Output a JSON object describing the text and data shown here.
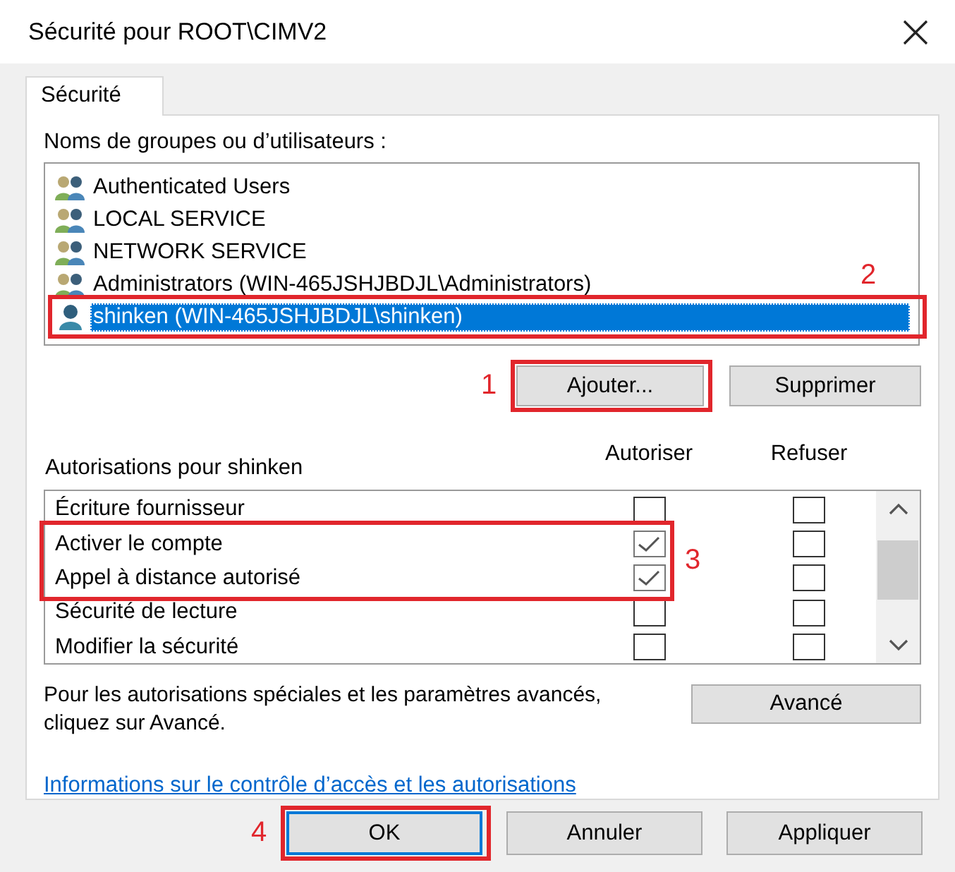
{
  "window": {
    "title": "Sécurité pour ROOT\\CIMV2"
  },
  "tabs": [
    {
      "label": "Sécurité",
      "selected": true
    }
  ],
  "groups": {
    "label": "Noms de groupes ou d’utilisateurs :",
    "callout": "2",
    "items": [
      {
        "name": "Authenticated Users",
        "kind": "group",
        "selected": false,
        "highlighted": false
      },
      {
        "name": "LOCAL SERVICE",
        "kind": "group",
        "selected": false,
        "highlighted": false
      },
      {
        "name": "NETWORK SERVICE",
        "kind": "group",
        "selected": false,
        "highlighted": false
      },
      {
        "name": "Administrators (WIN-465JSHJBDJL\\Administrators)",
        "kind": "group",
        "selected": false,
        "highlighted": false
      },
      {
        "name": "shinken (WIN-465JSHJBDJL\\shinken)",
        "kind": "user",
        "selected": true,
        "highlighted": true
      }
    ]
  },
  "group_buttons": [
    {
      "label": "Ajouter...",
      "highlighted": true,
      "callout": "1"
    },
    {
      "label": "Supprimer"
    }
  ],
  "permissions": {
    "label": "Autorisations pour shinken",
    "allow_header": "Autoriser",
    "deny_header": "Refuser",
    "callout": "3",
    "rows": [
      {
        "name": "Écriture fournisseur",
        "allow": false,
        "deny": false,
        "highlighted": false
      },
      {
        "name": "Activer le compte",
        "allow": true,
        "deny": false,
        "highlighted": true
      },
      {
        "name": "Appel à distance autorisé",
        "allow": true,
        "deny": false,
        "highlighted": true
      },
      {
        "name": "Sécurité de lecture",
        "allow": false,
        "deny": false,
        "highlighted": false
      },
      {
        "name": "Modifier la sécurité",
        "allow": false,
        "deny": false,
        "highlighted": false
      }
    ]
  },
  "advanced": {
    "text": "Pour les autorisations spéciales et les paramètres avancés, cliquez sur Avancé.",
    "button": "Avancé"
  },
  "link": "Informations sur le contrôle d’accès et les autorisations",
  "dialog_buttons": [
    {
      "label": "OK",
      "default": true,
      "highlighted": true,
      "callout": "4"
    },
    {
      "label": "Annuler",
      "default": false
    },
    {
      "label": "Appliquer",
      "default": false
    }
  ]
}
